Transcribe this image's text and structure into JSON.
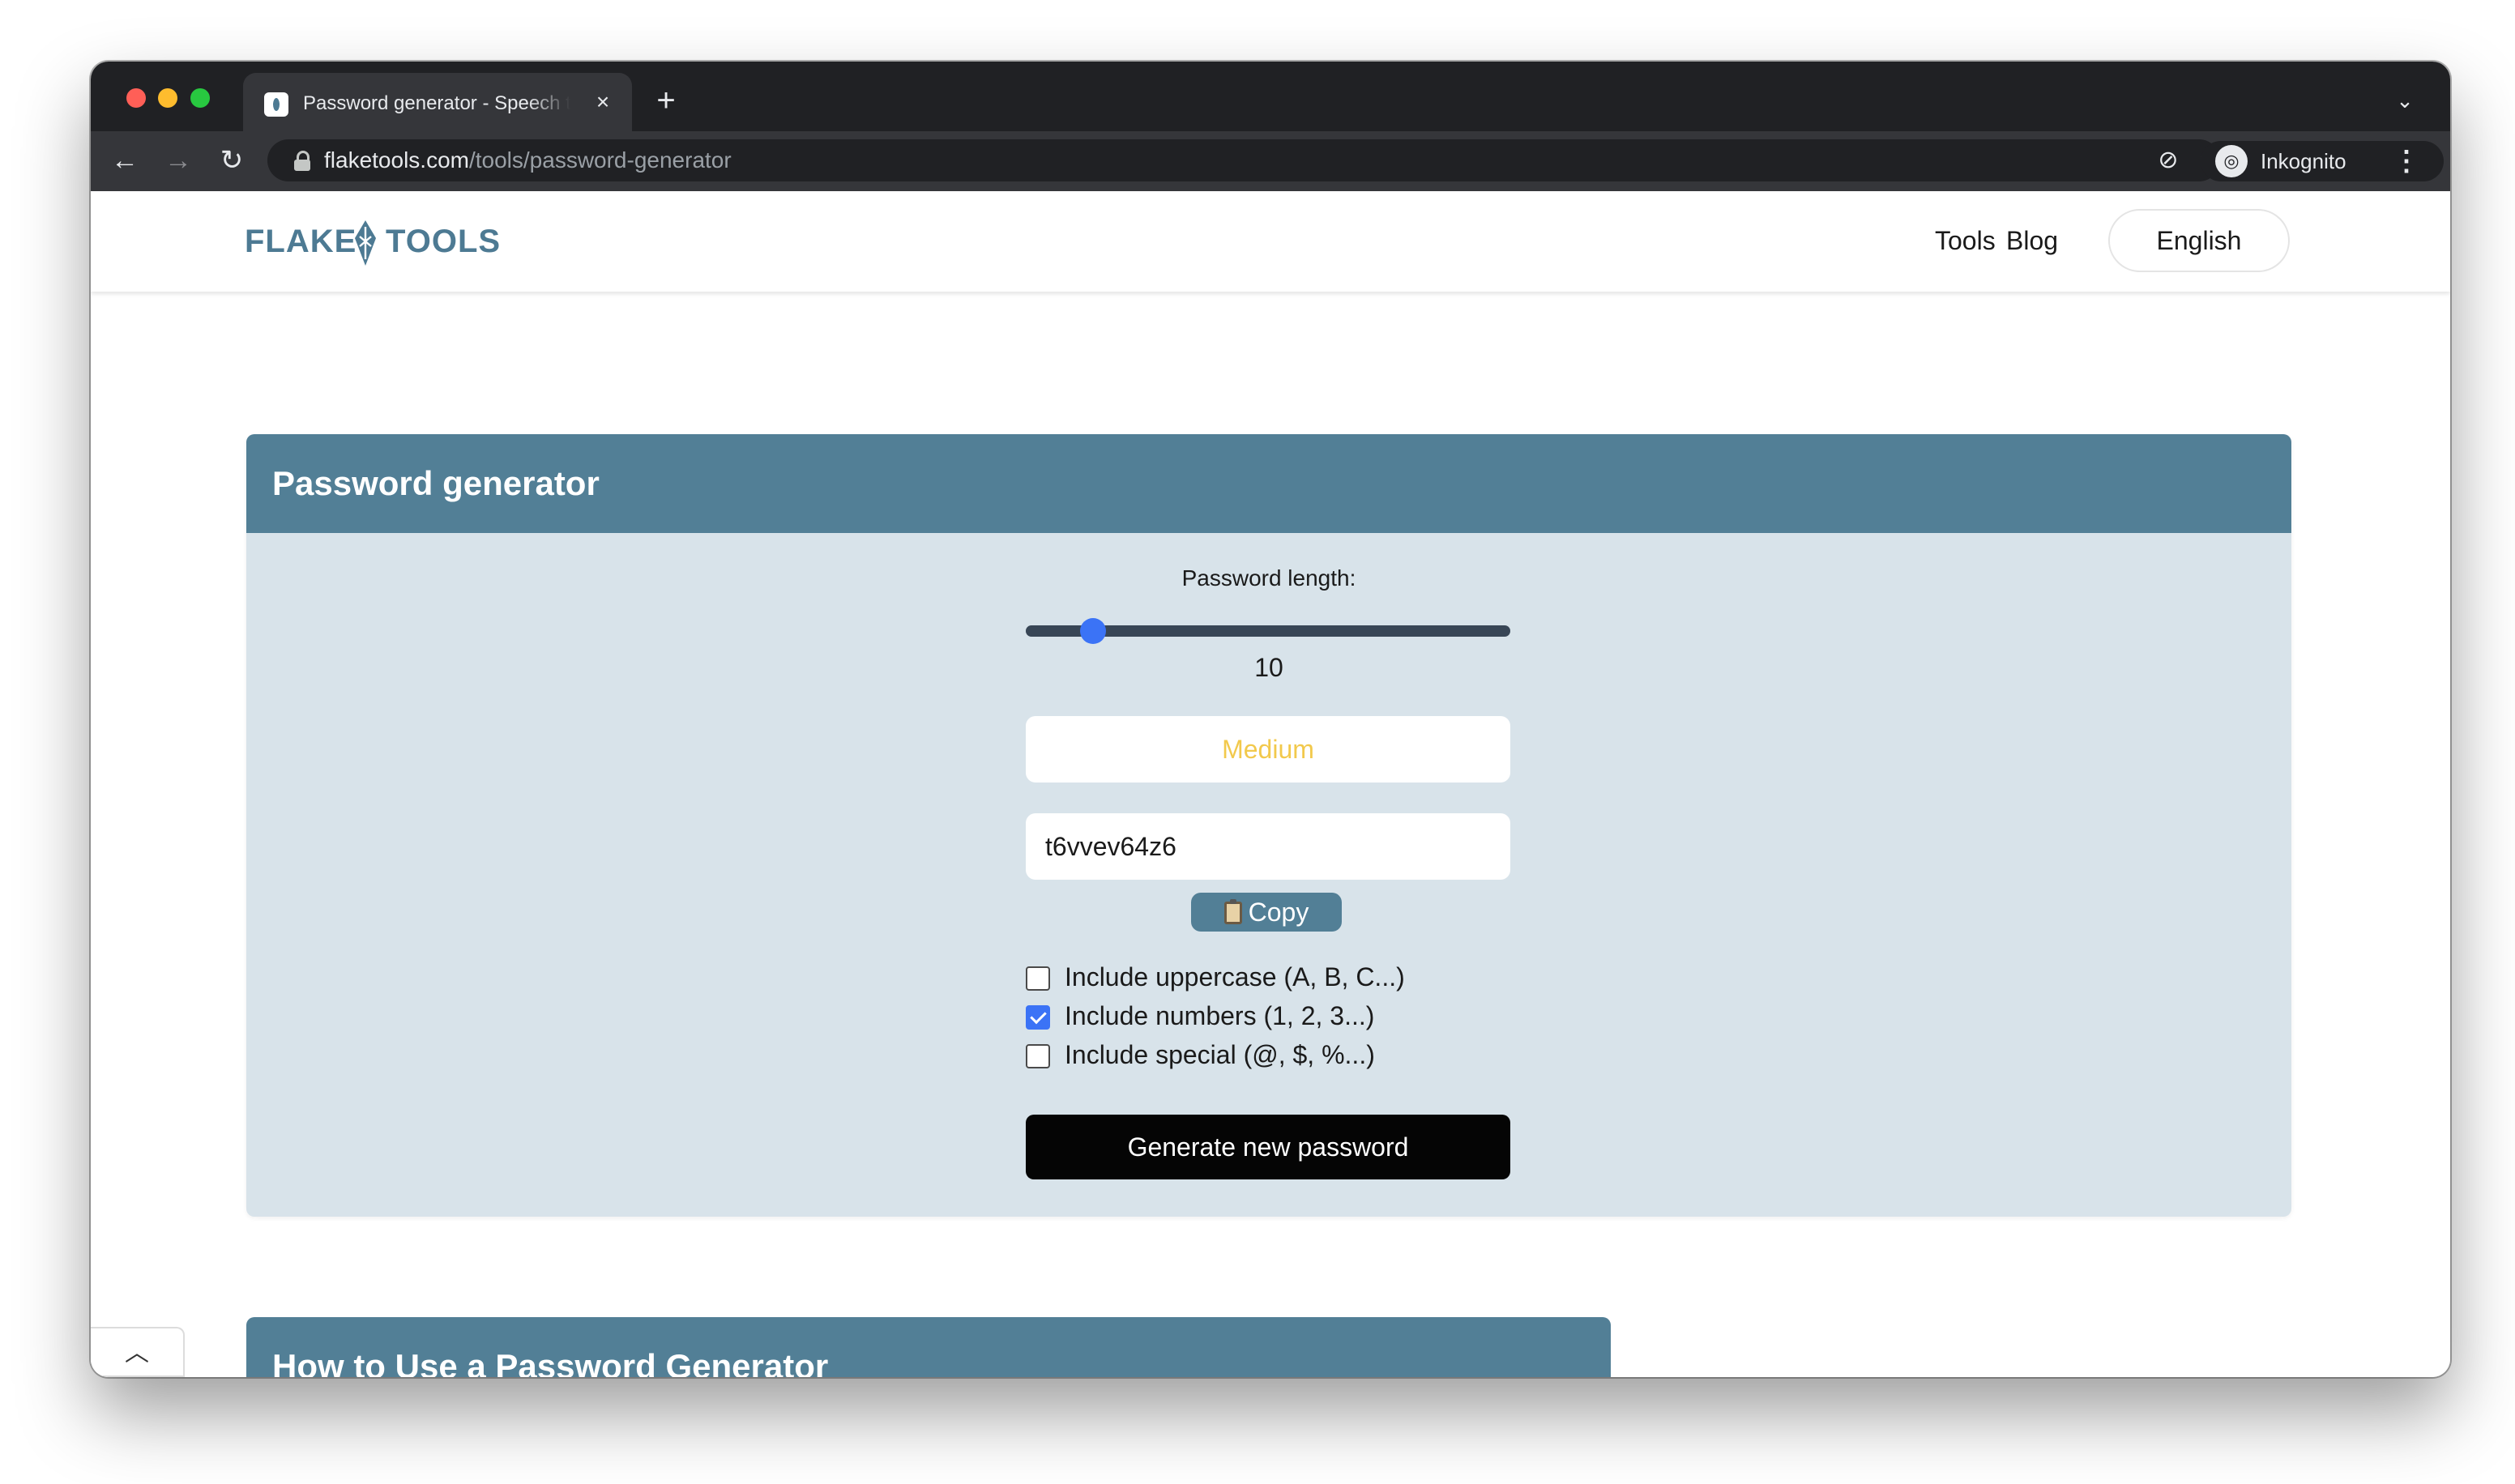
{
  "browser": {
    "tab_title": "Password generator - Speech to Text",
    "tab_close_icon": "×",
    "new_tab_icon": "+",
    "tab_search_icon": "⌄",
    "back_icon": "←",
    "forward_icon": "→",
    "reload_icon": "↻",
    "url_host": "flaketools.com",
    "url_path": "/tools/password-generator",
    "eye_off_icon": "⊘",
    "star_icon": "☆",
    "incognito_icon": "◎",
    "profile_label": "Inkognito",
    "menu_icon": "⋮"
  },
  "site": {
    "logo_left": "FLAKE",
    "logo_right": "TOOLS",
    "nav": {
      "tools": "Tools",
      "blog": "Blog",
      "language": "English"
    }
  },
  "generator": {
    "title": "Password generator",
    "length_label": "Password length:",
    "length_value": "10",
    "length_slider_fraction": 0.21,
    "strength": "Medium",
    "password": "t6vvev64z6",
    "copy_label": "Copy",
    "options": [
      {
        "label": "Include uppercase (A, B, C...)",
        "checked": false
      },
      {
        "label": "Include numbers (1, 2, 3...)",
        "checked": true
      },
      {
        "label": "Include special (@, $, %...)",
        "checked": false
      }
    ],
    "generate_label": "Generate new password"
  },
  "howto": {
    "title": "How to Use a Password Generator"
  },
  "scroll_top_icon": "︿",
  "colors": {
    "brand": "#527f96",
    "card_bg": "#d8e3ea",
    "accent": "#3b73f6",
    "strength_medium": "#f2c94c"
  }
}
